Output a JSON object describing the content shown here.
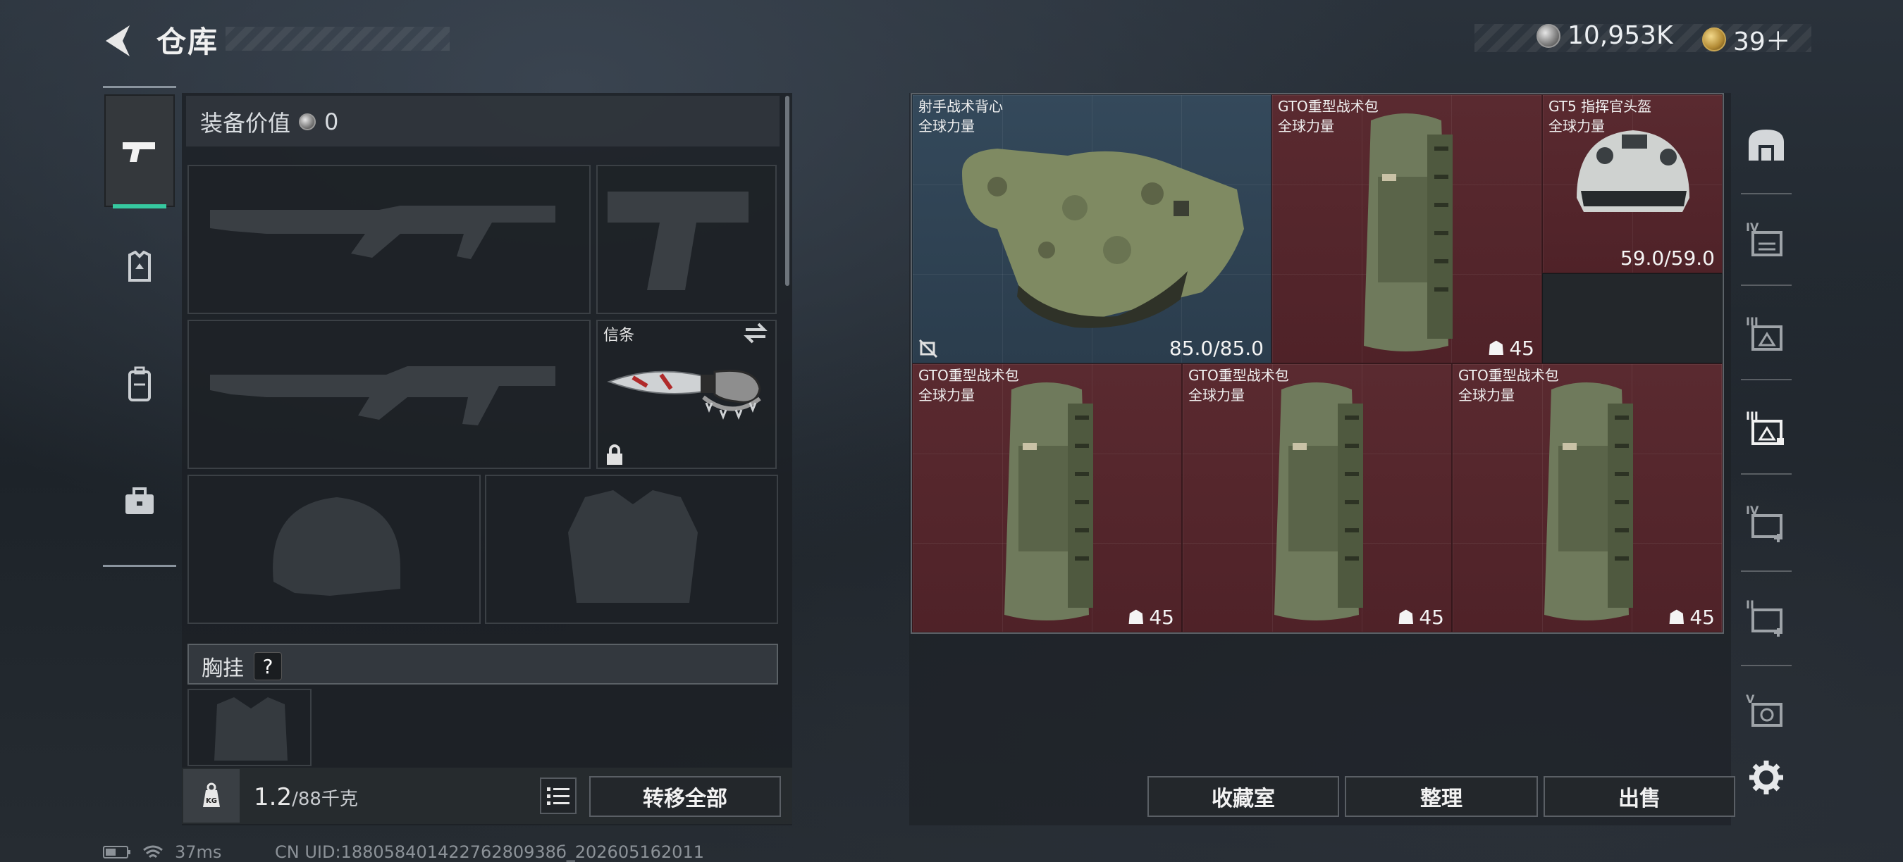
{
  "header": {
    "title": "仓库"
  },
  "currency": {
    "coins": "10,953K",
    "gold": "39＋"
  },
  "left_tabs": [
    "pistol-icon",
    "armor-icon",
    "backpack-icon",
    "toolbox-icon"
  ],
  "loadout": {
    "equip_value_label": "装备价值",
    "equip_value": "0",
    "melee_label": "信条",
    "chest_label": "胸挂",
    "chest_help": "?",
    "weight_current": "1.2",
    "weight_max": "/88千克",
    "kg_label": "KG",
    "transfer_all": "转移全部"
  },
  "items": [
    {
      "name": "射手战术背心",
      "faction": "全球力量",
      "value": "85.0/85.0",
      "color": "blue"
    },
    {
      "name": "GTO重型战术包",
      "faction": "全球力量",
      "value": "45",
      "color": "red"
    },
    {
      "name": "GT5 指挥官头盔",
      "faction": "全球力量",
      "value": "59.0/59.0",
      "color": "red"
    },
    {
      "name": "GTO重型战术包",
      "faction": "全球力量",
      "value": "45",
      "color": "red"
    },
    {
      "name": "GTO重型战术包",
      "faction": "全球力量",
      "value": "45",
      "color": "red"
    },
    {
      "name": "GTO重型战术包",
      "faction": "全球力量",
      "value": "45",
      "color": "red"
    }
  ],
  "right_tabs": [
    "home-icon",
    "IV",
    "III",
    "III",
    "IV",
    "II",
    "V"
  ],
  "actions": {
    "vault": "收藏室",
    "sort": "整理",
    "sell": "出售"
  },
  "status": {
    "ping": "37ms",
    "uid": "CN UID:18805840142276280938б_202605162011"
  }
}
